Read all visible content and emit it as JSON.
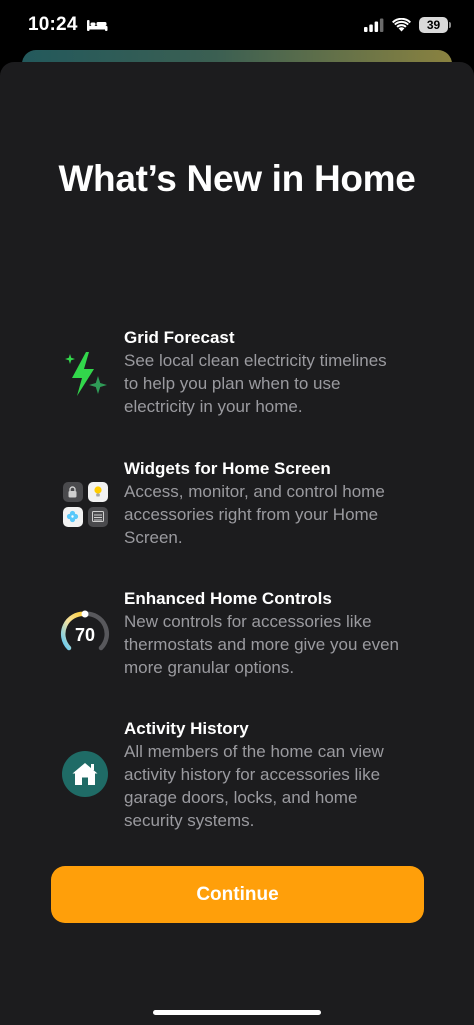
{
  "status_bar": {
    "time": "10:24",
    "battery_level": "39",
    "icons": [
      "bed-icon",
      "cellular-signal-icon",
      "wifi-icon",
      "battery-icon"
    ]
  },
  "sheet": {
    "title": "What’s New in Home",
    "features": [
      {
        "icon": "grid-forecast-bolt-icon",
        "title": "Grid Forecast",
        "description": "See local clean electricity timelines\nto help you plan when to use\nelectricity in your home."
      },
      {
        "icon": "widgets-grid-icon",
        "title": "Widgets for Home Screen",
        "description": "Access, monitor, and control home\naccessories right from your Home\nScreen."
      },
      {
        "icon": "thermostat-dial-icon",
        "title": "Enhanced Home Controls",
        "description": "New controls for accessories like\nthermostats and more give you even\nmore granular options.",
        "dial_value": "70"
      },
      {
        "icon": "home-activity-icon",
        "title": "Activity History",
        "description": "All members of the home can view\nactivity history for accessories like\ngarage doors, locks, and home\nsecurity systems."
      }
    ],
    "continue_label": "Continue"
  },
  "colors": {
    "sheet_background": "#1c1c1e",
    "accent_button": "#ff9f0a",
    "description_text": "#9a9a9f",
    "bolt_green": "#32d74b",
    "home_teal": "#1f6b66"
  }
}
